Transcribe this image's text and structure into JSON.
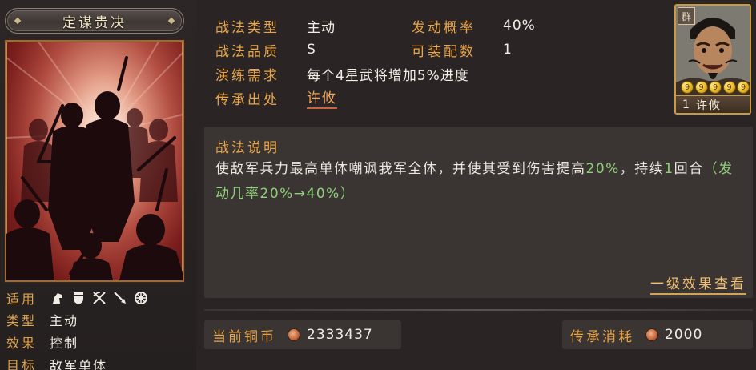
{
  "tactic": {
    "name": "定谋贵决"
  },
  "attributes": {
    "applicable_label": "适用",
    "applicable_icons": [
      "cavalry-icon",
      "shield-icon",
      "bow-icon",
      "spear-icon",
      "siege-icon"
    ],
    "type_label": "类型",
    "type_value": "主动",
    "effect_label": "效果",
    "effect_value": "控制",
    "target_label": "目标",
    "target_value": "敌军单体"
  },
  "info": {
    "tactic_type_label": "战法类型",
    "tactic_type_value": "主动",
    "trigger_rate_label": "发动概率",
    "trigger_rate_value": "40%",
    "quality_label": "战法品质",
    "quality_value": "S",
    "equip_count_label": "可装配数",
    "equip_count_value": "1",
    "training_label": "演练需求",
    "training_value": "每个4星武将增加5%进度",
    "source_label": "传承出处",
    "source_value": "许攸"
  },
  "general_card": {
    "faction": "群",
    "stars": [
      "9",
      "9",
      "9",
      "9",
      "9"
    ],
    "level": "1",
    "name": "许攸"
  },
  "description": {
    "title": "战法说明",
    "text_part1": "使敌军兵力最高单体嘲讽我军全体，并使其受到伤害提高",
    "text_highlight1": "20%",
    "text_part2": "，持续",
    "text_highlight2": "1",
    "text_part3": "回合",
    "text_paren_open": "（",
    "text_highlight3": "发动几率20%→40%",
    "text_paren_close": "）",
    "more_link": "一级效果查看"
  },
  "currency": {
    "coins_label": "当前铜币",
    "coins_value": "2333437",
    "cost_label": "传承消耗",
    "cost_value": "2000"
  },
  "colors": {
    "label_orange": "#e8a446",
    "highlight_green": "#8fd07a",
    "link_orange": "#f0a35a",
    "gold_border": "#c99a3e"
  }
}
